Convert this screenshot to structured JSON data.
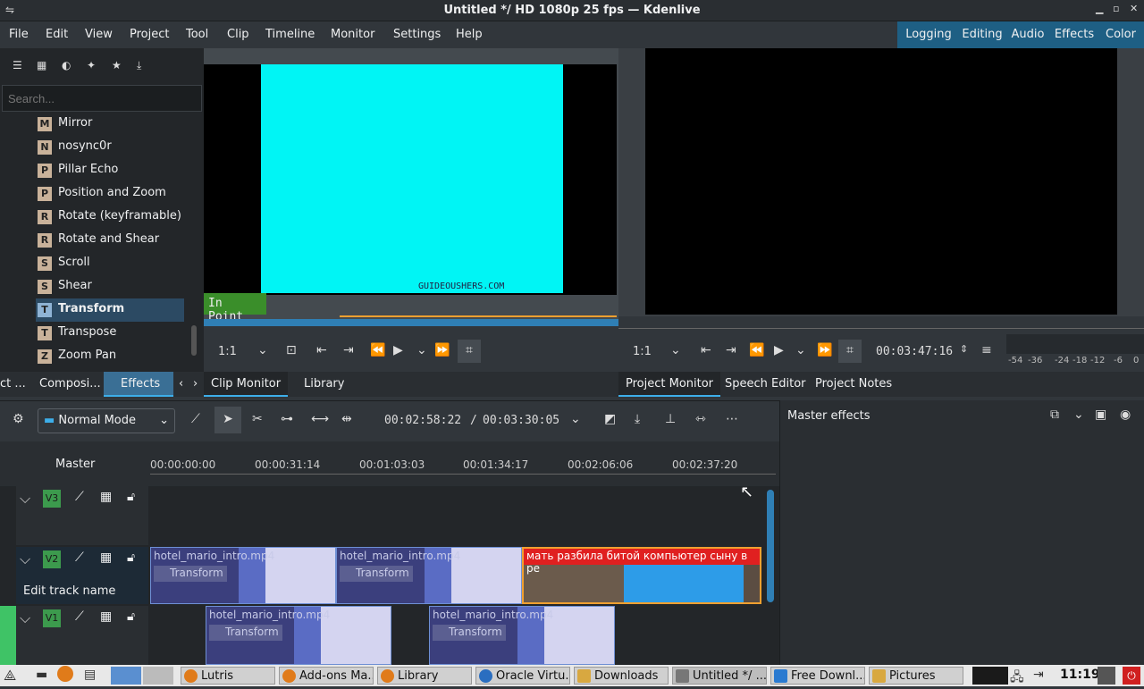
{
  "window": {
    "title": "Untitled */ HD 1080p 25 fps — Kdenlive"
  },
  "menu": [
    "File",
    "Edit",
    "View",
    "Project",
    "Tool",
    "Clip",
    "Timeline",
    "Monitor",
    "Settings",
    "Help"
  ],
  "workspaces": [
    "Logging",
    "Editing",
    "Audio",
    "Effects",
    "Color"
  ],
  "effects_panel": {
    "search_placeholder": "Search...",
    "items": [
      {
        "letter": "M",
        "label": "Mirror"
      },
      {
        "letter": "N",
        "label": "nosync0r"
      },
      {
        "letter": "P",
        "label": "Pillar Echo"
      },
      {
        "letter": "P",
        "label": "Position and Zoom"
      },
      {
        "letter": "R",
        "label": "Rotate (keyframable)"
      },
      {
        "letter": "R",
        "label": "Rotate and Shear"
      },
      {
        "letter": "S",
        "label": "Scroll"
      },
      {
        "letter": "S",
        "label": "Shear"
      },
      {
        "letter": "T",
        "label": "Transform",
        "selected": true
      },
      {
        "letter": "T",
        "label": "Transpose"
      },
      {
        "letter": "Z",
        "label": "Zoom Pan"
      }
    ],
    "tabs": [
      "ct ...",
      "Composi...",
      "Effects"
    ]
  },
  "clip_monitor": {
    "in_point_label": "In Point",
    "watermark": "GUIDEOUSHERS.COM",
    "zoom": "1:1",
    "tabs": [
      "Clip Monitor",
      "Library"
    ]
  },
  "project_monitor": {
    "zoom": "1:1",
    "timecode": "00:03:47:16",
    "meter_labels": [
      "-54",
      "-36",
      "-24",
      "-18",
      "-12",
      "-6",
      "0"
    ],
    "tabs": [
      "Project Monitor",
      "Speech Editor",
      "Project Notes"
    ]
  },
  "timeline": {
    "mode": "Normal Mode",
    "position": "00:02:58:22",
    "duration": "00:03:30:05",
    "separator": "/",
    "master_label": "Master",
    "ruler_ticks": [
      "00:00:00:00",
      "00:00:31:14",
      "00:01:03:03",
      "00:01:34:17",
      "00:02:06:06",
      "00:02:37:20"
    ],
    "tracks": [
      {
        "name": "V3"
      },
      {
        "name": "V2",
        "edit_label": "Edit track name"
      },
      {
        "name": "V1"
      }
    ],
    "clips": {
      "v2_a": {
        "name": "hotel_mario_intro.mp4",
        "effect": "Transform"
      },
      "v2_b": {
        "name": "hotel_mario_intro.mp4",
        "effect": "Transform"
      },
      "v2_c": {
        "name": "мать разбила битой компьютер сыну в ре"
      },
      "v1_a": {
        "name": "hotel_mario_intro.mp4",
        "effect": "Transform"
      },
      "v1_b": {
        "name": "hotel_mario_intro.mp4",
        "effect": "Transform"
      }
    }
  },
  "master_effects": {
    "title": "Master effects"
  },
  "taskbar": {
    "tasks": [
      "Lutris",
      "Add-ons Ma...",
      "Library",
      "Oracle Virtu...",
      "Downloads",
      "Untitled */ ...",
      "Free Downl...",
      "Pictures"
    ],
    "clock": "11:19"
  },
  "colors": {
    "accent": "#3daee9",
    "clip": "#3b3f7d",
    "highlight_clip": "#e02020",
    "cyan": "#00f5f5"
  }
}
